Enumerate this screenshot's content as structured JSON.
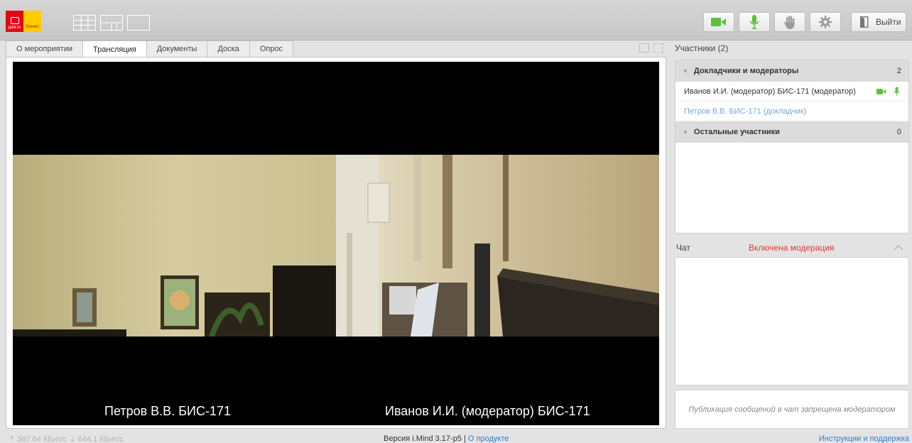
{
  "brand": {
    "logo_text_left": "дом.ru",
    "logo_text_right": "бизнес"
  },
  "toolbar": {
    "exit_label": "Выйти"
  },
  "tabs": [
    {
      "label": "О мероприятии"
    },
    {
      "label": "Трансляция"
    },
    {
      "label": "Документы"
    },
    {
      "label": "Доска"
    },
    {
      "label": "Опрос"
    }
  ],
  "video": {
    "left_name": "Петров В.В. БИС-171",
    "right_name": "Иванов И.И. (модератор) БИС-171"
  },
  "participants": {
    "header": "Участники (2)",
    "groups": [
      {
        "title": "Докладчики и модераторы",
        "count": "2"
      },
      {
        "title": "Остальные участники",
        "count": "0"
      }
    ],
    "members": [
      {
        "name": "Иванов И.И. (модератор) БИС-171 (модератор)"
      },
      {
        "name": "Петров В.В. БИС-171 (докладчик)"
      }
    ]
  },
  "chat": {
    "title": "Чат",
    "moderation": "Включена модерация",
    "input_notice": "Публикация сообщений в чат запрещена модератором"
  },
  "status": {
    "bitrate": "⇡ 387.64 КБит/с  ⇣ 644.1 КБит/с",
    "version": "Версия i.Mind 3.17-p5  |  ",
    "about": "О продукте",
    "help": "Инструкции и поддержка"
  },
  "colors": {
    "accent_green": "#5cc13a",
    "moderation_red": "#e53935",
    "link_blue": "#2f7fd2"
  }
}
